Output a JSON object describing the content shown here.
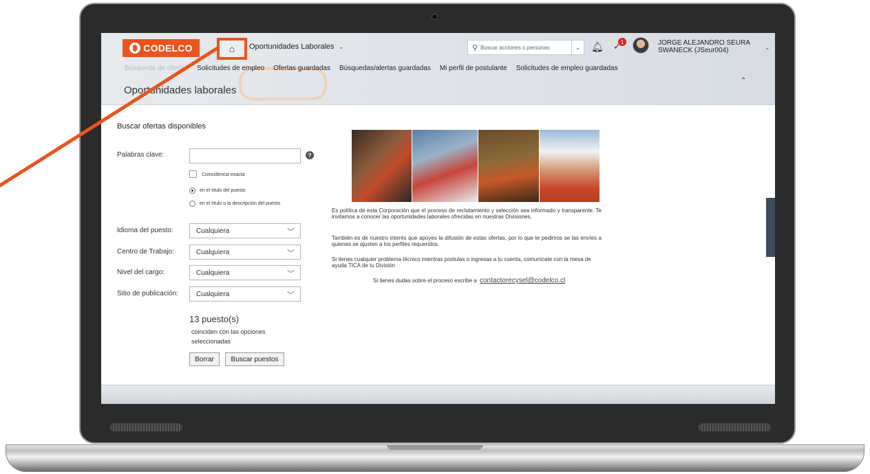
{
  "header": {
    "logo_text": "CODELCO",
    "app_title": "Oportunidades Laborales",
    "search_placeholder": "Buscar acciones o personas",
    "notification_count": "1",
    "user_name": "JORGE ALEJANDRO SEURA SWANECK (JSeur004)"
  },
  "nav": {
    "items": [
      "Búsqueda de ofertas",
      "Solicitudes de empleo",
      "Ofertas guardadas",
      "Búsquedas/alertas guardadas",
      "Mi perfil de postulante",
      "Solicitudes de empleo guardadas"
    ]
  },
  "page": {
    "title": "Oportunidades laborales"
  },
  "search": {
    "section_title": "Buscar ofertas disponibles",
    "keywords_label": "Palabras clave:",
    "exact_match_label": "Coincidencia exacta",
    "radio_title_label": "en el título del puesto",
    "radio_title_desc_label": "en el título o la descripción del puesto",
    "language_label": "Idioma del puesto:",
    "language_value": "Cualquiera",
    "workplace_label": "Centro de Trabajo:",
    "workplace_value": "Cualquiera",
    "level_label": "Nivel del cargo:",
    "level_value": "Cualquiera",
    "site_label": "Sitio de publicación:",
    "site_value": "Cualquiera",
    "result_count": "13 puesto(s)",
    "result_text": "coinciden con las opciones seleccionadas",
    "clear_button": "Borrar",
    "search_button": "Buscar puestos"
  },
  "info": {
    "p1": "Es política de esta Corporación que el proceso de reclutamiento y selección sea informado y transparente. Te invitamos a conocer las oportunidades laborales ofrecidas en nuestras Divisiones.",
    "p2": "También es de nuestro interés que apoyes la difusión de estas ofertas, por lo que te pedimos se las envíes a quienes se ajusten a los perfiles requeridos.",
    "p3": "Si tienes cualquier problema técnico mientras postulas o ingresas a tu cuenta, comunícate con la mesa de ayuda TICA de tu División",
    "contact_text": "Si tienes dudas sobre el proceso escribe a",
    "contact_email": "contactorecysel@codelco.cl"
  },
  "colors": {
    "brand": "#e8551f",
    "callout": "#e8551f"
  }
}
